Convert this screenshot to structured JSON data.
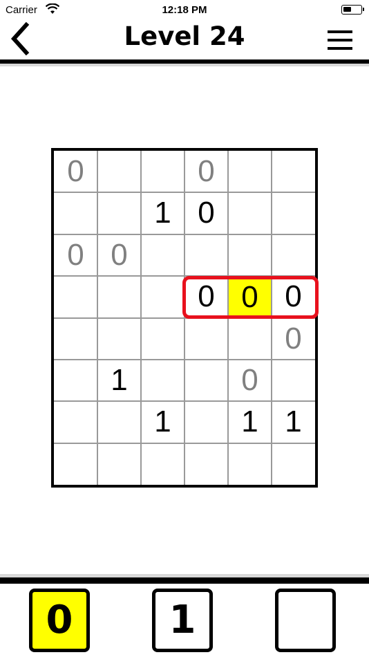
{
  "status_bar": {
    "carrier": "Carrier",
    "time": "12:18 PM"
  },
  "nav": {
    "title": "Level 24",
    "back_icon": "chevron-left-icon",
    "menu_icon": "hamburger-menu-icon"
  },
  "board": {
    "rows": 8,
    "cols": 6,
    "cells": [
      {
        "r": 0,
        "c": 0,
        "v": "0",
        "t": "user"
      },
      {
        "r": 0,
        "c": 3,
        "v": "0",
        "t": "user"
      },
      {
        "r": 1,
        "c": 2,
        "v": "1",
        "t": "fixed"
      },
      {
        "r": 1,
        "c": 3,
        "v": "0",
        "t": "fixed"
      },
      {
        "r": 2,
        "c": 0,
        "v": "0",
        "t": "user"
      },
      {
        "r": 2,
        "c": 1,
        "v": "0",
        "t": "user"
      },
      {
        "r": 3,
        "c": 3,
        "v": "0",
        "t": "fixed"
      },
      {
        "r": 3,
        "c": 4,
        "v": "0",
        "t": "fixed",
        "highlight": true
      },
      {
        "r": 3,
        "c": 5,
        "v": "0",
        "t": "fixed"
      },
      {
        "r": 4,
        "c": 5,
        "v": "0",
        "t": "user"
      },
      {
        "r": 5,
        "c": 1,
        "v": "1",
        "t": "fixed"
      },
      {
        "r": 5,
        "c": 4,
        "v": "0",
        "t": "user"
      },
      {
        "r": 6,
        "c": 2,
        "v": "1",
        "t": "fixed"
      },
      {
        "r": 6,
        "c": 4,
        "v": "1",
        "t": "fixed"
      },
      {
        "r": 6,
        "c": 5,
        "v": "1",
        "t": "fixed"
      }
    ],
    "hint_color": "#e8111d",
    "highlight_color": "#ffff00",
    "user_digit_color": "#808080"
  },
  "keypad": {
    "keys": [
      {
        "label": "0",
        "selected": true
      },
      {
        "label": "1",
        "selected": false
      },
      {
        "label": "",
        "selected": false
      }
    ]
  }
}
